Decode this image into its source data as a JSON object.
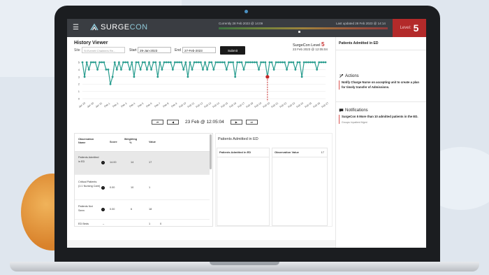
{
  "app": {
    "logo_text_a": "SURGE",
    "logo_text_b": "CON",
    "menu_icon": "hamburger-icon",
    "status_current": "Currently 28 Feb 2023 @ 14:09",
    "status_updated": "Last updated 28 Feb 2023 @ 14:14",
    "level_label": "Level:",
    "level_value": "5",
    "accent": "#c62828",
    "teal": "#2a9d8f"
  },
  "history": {
    "title": "History Viewer",
    "site_label": "Site",
    "site_placeholder": "St Everett Chalmers Re...",
    "start_label": "Start",
    "start_value": "29-Jan-2023",
    "end_label": "End",
    "end_value": "27-Feb-2023",
    "submit_label": "Submit",
    "sc_level_prefix": "SurgeCon Level",
    "sc_level_value": "5",
    "sc_date": "23 Feb 2023 @ 12:05:04"
  },
  "chart_data": {
    "type": "line",
    "ylim": [
      0,
      5
    ],
    "yticks": [
      "5",
      "4",
      "3",
      "2",
      "1",
      "0"
    ],
    "x_labels": [
      "Jan 29",
      "Jan 30",
      "Jan 31",
      "Feb 1",
      "Feb 2",
      "Feb 3",
      "Feb 4",
      "Feb 5",
      "Feb 6",
      "Feb 7",
      "Feb 8",
      "Feb 9",
      "Feb 10",
      "Feb 11",
      "Feb 12",
      "Feb 13",
      "Feb 14",
      "Feb 15",
      "Feb 16",
      "Feb 17",
      "Feb 18",
      "Feb 19",
      "Feb 20",
      "Feb 21",
      "Feb 22",
      "Feb 23",
      "Feb 24",
      "Feb 25",
      "Feb 26",
      "Feb 27"
    ],
    "values": [
      5,
      3,
      5,
      4,
      5,
      5,
      5,
      4,
      5,
      5,
      5,
      4,
      4,
      2,
      3,
      5,
      4,
      5,
      4,
      5,
      5,
      5,
      4,
      5,
      3,
      5,
      5,
      4,
      5,
      5,
      4,
      5,
      4,
      5,
      5,
      3,
      5,
      4,
      5,
      5,
      5,
      5,
      4,
      5,
      5,
      5,
      5,
      4,
      5,
      3,
      5,
      4,
      5,
      5,
      5,
      5,
      4,
      5,
      4,
      5,
      5,
      4,
      5,
      5,
      5,
      5,
      5,
      4,
      5,
      5,
      5,
      3,
      5,
      5,
      5,
      4,
      5,
      5,
      5,
      5,
      5,
      5,
      4,
      5,
      5,
      5,
      3,
      5,
      5,
      4,
      5,
      5,
      5,
      5,
      5,
      4,
      5,
      5,
      5,
      4,
      5,
      5,
      3,
      5,
      5,
      5,
      5,
      5,
      5,
      4,
      5,
      5,
      5,
      5
    ],
    "highlight_index": 86
  },
  "nav": {
    "first": "⏮",
    "prev": "◀",
    "current": "23 Feb @ 12:05:04",
    "next": "▶",
    "last": "⏭"
  },
  "table": {
    "headers": [
      "Observation Name",
      "Score",
      "Weighting %",
      "Value"
    ],
    "rows": [
      {
        "name": "Patients Admitted in ED",
        "score": "14.00",
        "weight": "14",
        "value": "17",
        "selected": true
      },
      {
        "name": "Critical Patients (1:1 Nursing Care)",
        "score": "0.00",
        "weight": "10",
        "value": "1",
        "selected": false
      },
      {
        "name": "Patients Not Seen",
        "score": "0.00",
        "weight": "6",
        "value": "18",
        "selected": false
      },
      {
        "name": "ED Beds",
        "score": "",
        "weight": "1",
        "value": "0",
        "selected": false
      }
    ]
  },
  "detail": {
    "title": "Patients Admitted in ED",
    "col1_header": "Patients Admitted in ED",
    "col2_header": "Observation Value",
    "col2_value": "17"
  },
  "right": {
    "title": "Patients Admitted in ED",
    "actions_label": "Actions",
    "action_text": "Notify Charge Nurse on accepting unit to create a plan for timely transfer of Admissions.",
    "notifications_label": "Notifications",
    "notification_text": "SurgeCon 5 More than 10 admitted patients in the ED.",
    "notification_sub": "Groups: Inpatient Mgmt"
  }
}
